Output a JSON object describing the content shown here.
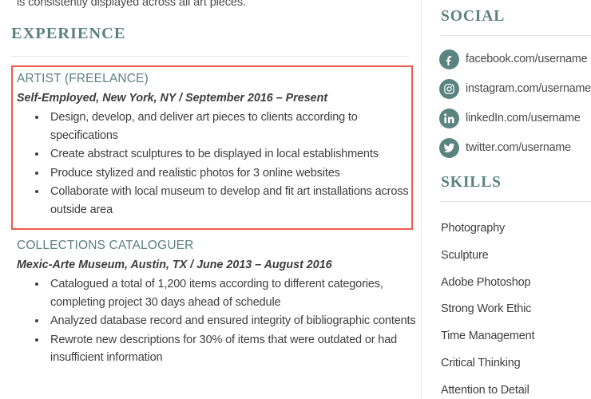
{
  "document": {
    "type": "resume",
    "accent_color": "#5b817d",
    "highlight_color": "#f05a4f",
    "text_color": "#3f3f3f"
  },
  "left_column": {
    "clipped_top_line": "is consistently displayed across all art pieces.",
    "section_heading": "EXPERIENCE",
    "jobs": [
      {
        "title": "ARTIST (FREELANCE)",
        "meta": "Self-Employed, New York, NY  /  September 2016 – Present",
        "highlighted": true,
        "bullets": [
          "Design, develop, and deliver art pieces to clients according to specifications",
          "Create abstract sculptures to be displayed in local establishments",
          "Produce stylized and realistic photos for 3 online websites",
          "Collaborate with local museum to develop and fit art installations across outside area"
        ]
      },
      {
        "title": "COLLECTIONS CATALOGUER",
        "meta": "Mexic-Arte Museum, Austin, TX  /  June 2013 – August 2016",
        "highlighted": false,
        "bullets": [
          "Catalogued a total of 1,200 items according to different categories, completing project 30 days ahead of schedule",
          "Analyzed database record and ensured integrity of bibliographic contents",
          "Rewrote new descriptions for 30% of items that were outdated or had insufficient information"
        ]
      }
    ]
  },
  "right_column": {
    "social": {
      "heading": "SOCIAL",
      "items": [
        {
          "icon": "facebook-icon",
          "label": "facebook.com/username"
        },
        {
          "icon": "instagram-icon",
          "label": "instagram.com/username"
        },
        {
          "icon": "linkedin-icon",
          "label": "linkedIn.com/username"
        },
        {
          "icon": "twitter-icon",
          "label": "twitter.com/username"
        }
      ]
    },
    "skills": {
      "heading": "SKILLS",
      "items": [
        "Photography",
        "Sculpture",
        "Adobe Photoshop",
        "Strong Work Ethic",
        "Time Management",
        "Critical Thinking",
        "Attention to Detail"
      ]
    }
  }
}
